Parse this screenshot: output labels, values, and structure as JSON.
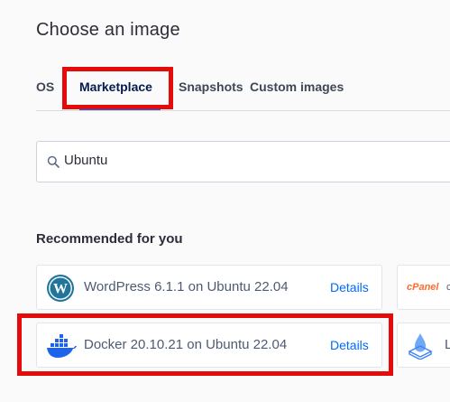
{
  "page": {
    "title": "Choose an image"
  },
  "tabs": [
    {
      "label": "OS"
    },
    {
      "label": "Marketplace"
    },
    {
      "label": "Snapshots"
    },
    {
      "label": "Custom images"
    }
  ],
  "active_tab": "Marketplace",
  "search": {
    "value": "Ubuntu",
    "placeholder": ""
  },
  "recommended": {
    "heading": "Recommended for you",
    "items": [
      {
        "name": "WordPress 6.1.1 on Ubuntu 22.04",
        "details_label": "Details",
        "icon": "wordpress-icon"
      },
      {
        "name": "Docker 20.10.21 on Ubuntu 22.04",
        "details_label": "Details",
        "icon": "docker-icon"
      }
    ],
    "partial_items": [
      {
        "logo_text": "cPanel",
        "name_start": "c",
        "icon": "cpanel-icon"
      },
      {
        "name_start": "L",
        "icon": "stack-icon"
      }
    ]
  },
  "colors": {
    "accent": "#0069ff",
    "highlight": "#e50b0b",
    "wordpress": "#21759b",
    "docker": "#1d63ed",
    "cpanel": "#ff6c2c"
  }
}
